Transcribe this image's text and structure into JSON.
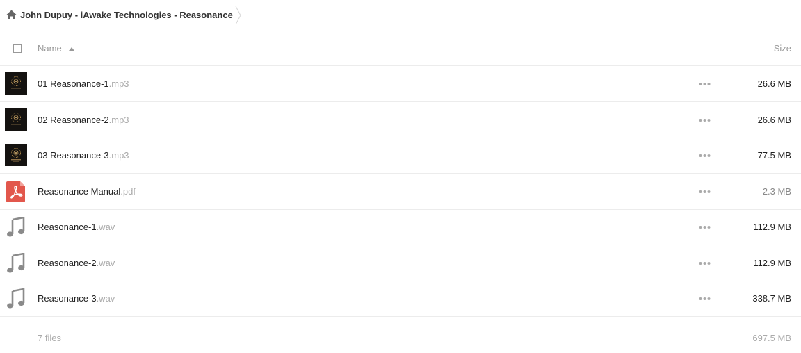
{
  "breadcrumb": {
    "title": "John Dupuy - iAwake Technologies - Reasonance"
  },
  "header": {
    "name_label": "Name",
    "size_label": "Size"
  },
  "files": [
    {
      "name": "01 Reasonance-1",
      "ext": ".mp3",
      "size": "26.6 MB",
      "icon": "album-art-thumbnail"
    },
    {
      "name": "02 Reasonance-2",
      "ext": ".mp3",
      "size": "26.6 MB",
      "icon": "album-art-thumbnail"
    },
    {
      "name": "03 Reasonance-3",
      "ext": ".mp3",
      "size": "77.5 MB",
      "icon": "album-art-thumbnail"
    },
    {
      "name": "Reasonance Manual",
      "ext": ".pdf",
      "size": "2.3 MB",
      "icon": "pdf-icon"
    },
    {
      "name": "Reasonance-1",
      "ext": ".wav",
      "size": "112.9 MB",
      "icon": "music-note-icon"
    },
    {
      "name": "Reasonance-2",
      "ext": ".wav",
      "size": "112.9 MB",
      "icon": "music-note-icon"
    },
    {
      "name": "Reasonance-3",
      "ext": ".wav",
      "size": "338.7 MB",
      "icon": "music-note-icon"
    }
  ],
  "footer": {
    "file_count": "7 files",
    "total_size": "697.5 MB"
  },
  "colors": {
    "pdf_red": "#e2574c",
    "music_gray": "#8a8a8a",
    "text_muted": "#aaaaaa"
  }
}
